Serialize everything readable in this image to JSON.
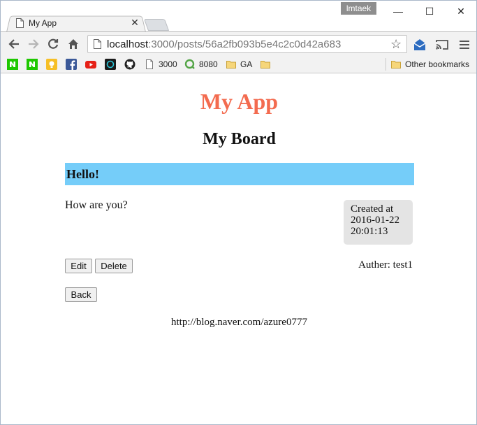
{
  "window": {
    "user_badge": "lmtaek",
    "minimize_glyph": "—",
    "maximize_glyph": "☐",
    "close_glyph": "✕"
  },
  "tab": {
    "title": "My App",
    "close_glyph": "✕",
    "icon": "page-icon"
  },
  "toolbar": {
    "url_host": "localhost",
    "url_rest": ":3000/posts/56a2fb093b5e4c2c0d42a683",
    "star_glyph": "☆"
  },
  "bookmarks": {
    "items": [
      {
        "label": "",
        "icon": "naver-icon",
        "color": "#1ec800"
      },
      {
        "label": "",
        "icon": "naver-icon",
        "color": "#1ec800"
      },
      {
        "label": "",
        "icon": "keep-icon",
        "color": "#f6bf26"
      },
      {
        "label": "",
        "icon": "facebook-icon",
        "color": "#3b5998"
      },
      {
        "label": "",
        "icon": "youtube-icon",
        "color": "#e62117"
      },
      {
        "label": "",
        "icon": "app-icon",
        "color": "#1a1a1a"
      },
      {
        "label": "",
        "icon": "github-icon",
        "color": "#222222"
      },
      {
        "label": "3000",
        "icon": "page-icon"
      },
      {
        "label": "8080",
        "icon": "qlik-icon",
        "color": "#54a547"
      },
      {
        "label": "GA",
        "icon": "folder-icon",
        "color": "#f0c34c"
      },
      {
        "label": "",
        "icon": "folder-icon",
        "color": "#f0c34c"
      }
    ],
    "other": "Other bookmarks"
  },
  "page": {
    "app_title": "My App",
    "board_title": "My Board",
    "post_title": "Hello!",
    "post_body": "How are you?",
    "created_label": "Created at",
    "created_date": "2016-01-22",
    "created_time": "20:01:13",
    "edit_label": "Edit",
    "delete_label": "Delete",
    "author": "Auther: test1",
    "back_label": "Back",
    "footer": "http://blog.naver.com/azure0777"
  },
  "colors": {
    "app_title": "#f36b4f",
    "post_title_bg": "#75cdf9",
    "created_bg": "#e4e4e4"
  }
}
